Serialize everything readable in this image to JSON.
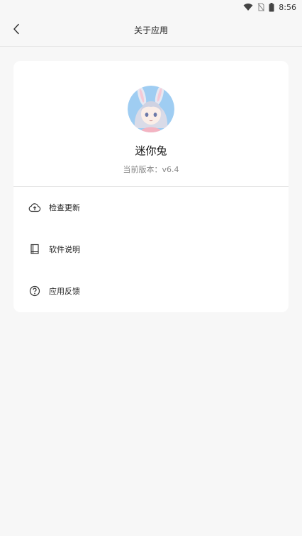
{
  "status_bar": {
    "time": "8:56",
    "icons": [
      "wifi-icon",
      "no-sim-icon",
      "battery-icon"
    ]
  },
  "header": {
    "title": "关于应用",
    "back_icon": "chevron-left-icon"
  },
  "app_info": {
    "name": "迷你兔",
    "version_text": "当前版本：v6.4",
    "avatar": "anime-girl-avatar"
  },
  "menu": {
    "items": [
      {
        "label": "检查更新",
        "icon": "cloud-upload-icon"
      },
      {
        "label": "软件说明",
        "icon": "book-icon"
      },
      {
        "label": "应用反馈",
        "icon": "help-circle-icon"
      }
    ]
  },
  "colors": {
    "background": "#f7f7f7",
    "card": "#ffffff",
    "divider": "#e4e4e4",
    "secondary_text": "#888888"
  }
}
